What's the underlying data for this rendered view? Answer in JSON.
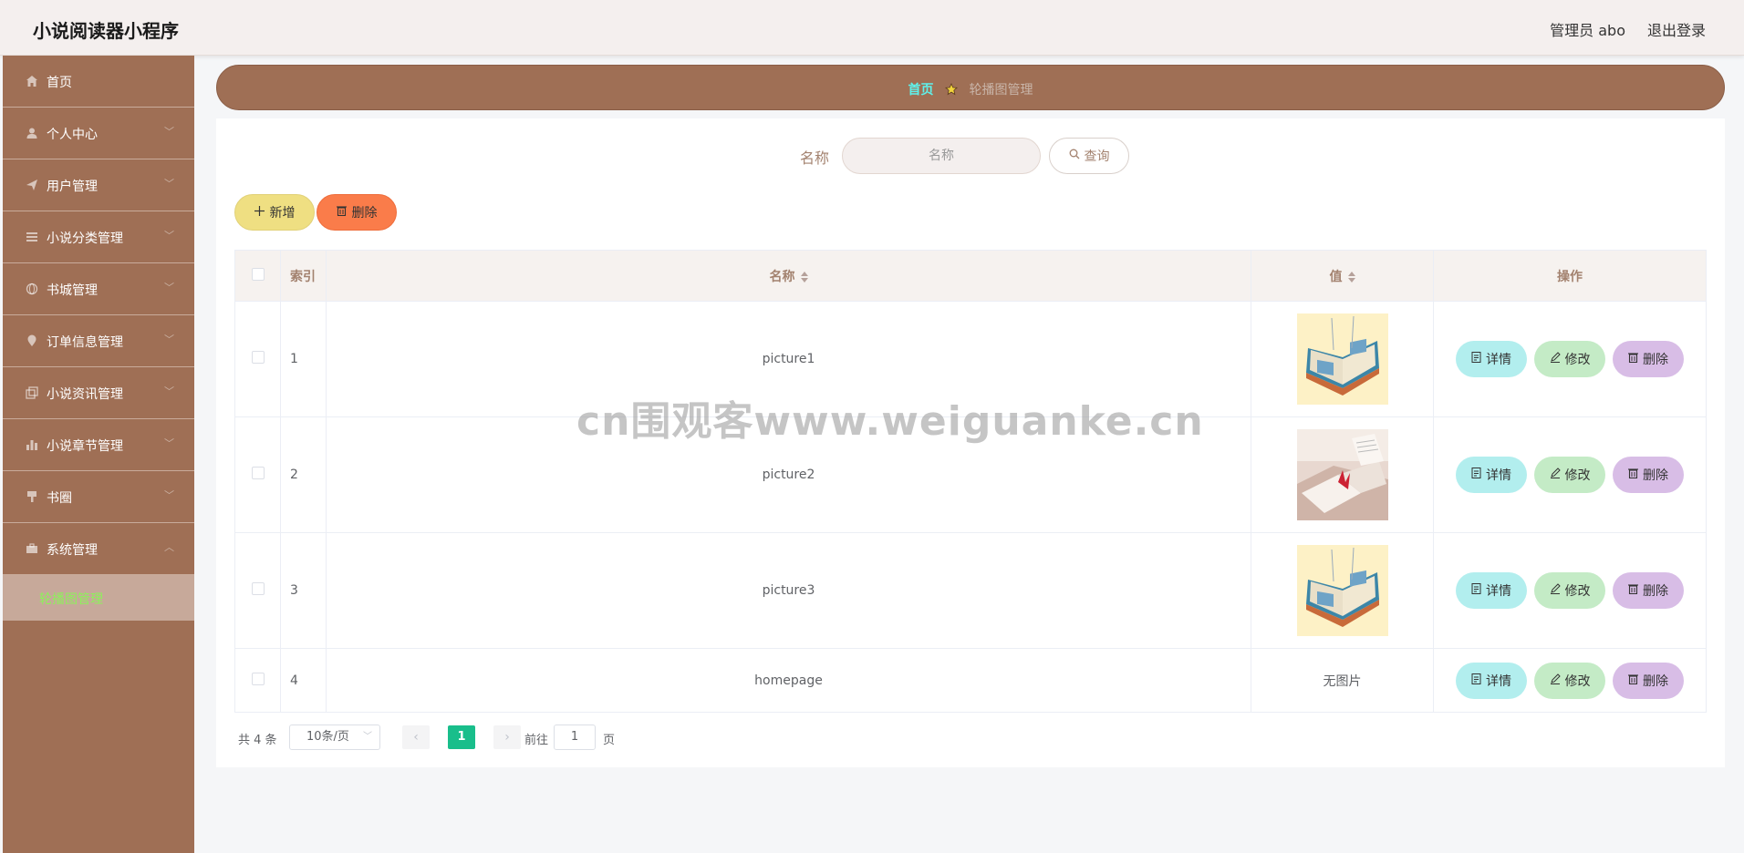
{
  "header": {
    "app_title": "小说阅读器小程序",
    "admin_label": "管理员 abo",
    "logout_label": "退出登录"
  },
  "sidebar": {
    "items": [
      {
        "label": "首页",
        "icon": "home-icon"
      },
      {
        "label": "个人中心",
        "icon": "user-icon"
      },
      {
        "label": "用户管理",
        "icon": "send-icon"
      },
      {
        "label": "小说分类管理",
        "icon": "menu-icon"
      },
      {
        "label": "书城管理",
        "icon": "globe-icon"
      },
      {
        "label": "订单信息管理",
        "icon": "location-icon"
      },
      {
        "label": "小说资讯管理",
        "icon": "copy-icon"
      },
      {
        "label": "小说章节管理",
        "icon": "bar-chart-icon"
      },
      {
        "label": "书圈",
        "icon": "brush-icon"
      },
      {
        "label": "系统管理",
        "icon": "suitcase-icon"
      }
    ],
    "active_sub": "轮播图管理"
  },
  "breadcrumb": {
    "home": "首页",
    "current": "轮播图管理"
  },
  "search": {
    "label": "名称",
    "placeholder": "名称",
    "button": "查询"
  },
  "toolbar": {
    "add": "新增",
    "delete": "删除"
  },
  "table": {
    "columns": [
      "索引",
      "名称",
      "值",
      "操作"
    ],
    "rows": [
      {
        "index": "1",
        "name": "picture1",
        "value_type": "image",
        "image": "book-open-illustration"
      },
      {
        "index": "2",
        "name": "picture2",
        "value_type": "image",
        "image": "book-photo"
      },
      {
        "index": "3",
        "name": "picture3",
        "value_type": "image",
        "image": "book-open-illustration"
      },
      {
        "index": "4",
        "name": "homepage",
        "value_type": "text",
        "value_text": "无图片"
      }
    ],
    "actions": {
      "detail": "详情",
      "edit": "修改",
      "remove": "删除"
    }
  },
  "pagination": {
    "total": "共 4 条",
    "page_size": "10条/页",
    "current_page": "1",
    "goto_label": "前往",
    "goto_value": "1",
    "page_unit": "页"
  },
  "watermark": "cn围观客www.weiguanke.cn",
  "colors": {
    "sidebar_bg": "#9f6f55",
    "header_bg": "#f4efee",
    "breadcrumb_home": "#5ef2ec",
    "active_sub_text": "#8cf25a",
    "add_button": "#efdf82",
    "delete_button": "#fa7c4a",
    "detail_button": "#b2eeee",
    "edit_button": "#c4ebc6",
    "remove_button": "#d8bde6",
    "current_page": "#19be8b"
  }
}
